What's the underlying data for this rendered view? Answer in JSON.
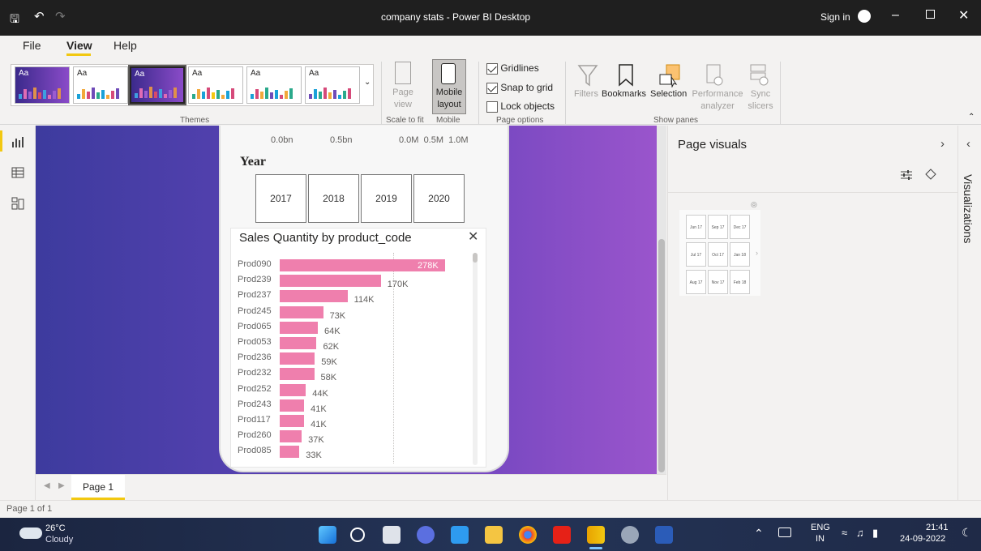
{
  "titlebar": {
    "title": "company stats - Power BI Desktop",
    "signin": "Sign in"
  },
  "menu": {
    "file": "File",
    "view": "View",
    "help": "Help"
  },
  "ribbon": {
    "themes_label": "Themes",
    "page_view": "Page view",
    "scale_to_fit": "Scale to fit",
    "mobile_layout": "Mobile layout",
    "mobile": "Mobile",
    "gridlines": "Gridlines",
    "snap_to_grid": "Snap to grid",
    "lock_objects": "Lock objects",
    "page_options": "Page options",
    "filters": "Filters",
    "bookmarks": "Bookmarks",
    "selection": "Selection",
    "performance": "Performance analyzer",
    "sync_slicers": "Sync slicers",
    "show_panes": "Show panes",
    "theme_aa": "Aa"
  },
  "phone": {
    "axis_left_0": "0.0bn",
    "axis_left_1": "0.5bn",
    "axis_right": "0.0M  0.5M  1.0M",
    "slicer_title": "Year",
    "years": [
      "2017",
      "2018",
      "2019",
      "2020"
    ]
  },
  "chart_data": {
    "type": "bar",
    "title": "Sales Quantity by product_code",
    "categories": [
      "Prod090",
      "Prod239",
      "Prod237",
      "Prod245",
      "Prod065",
      "Prod053",
      "Prod236",
      "Prod232",
      "Prod252",
      "Prod243",
      "Prod117",
      "Prod260",
      "Prod085"
    ],
    "values": [
      278000,
      170000,
      114000,
      73000,
      64000,
      62000,
      59000,
      58000,
      44000,
      41000,
      41000,
      37000,
      33000
    ],
    "labels": [
      "278K",
      "170K",
      "114K",
      "73K",
      "64K",
      "62K",
      "59K",
      "58K",
      "44K",
      "41K",
      "41K",
      "37K",
      "33K"
    ],
    "color": "#ef7fad"
  },
  "right_pane": {
    "title": "Page visuals",
    "vis_tab": "Visualizations",
    "mini_dates": [
      "Jun 17",
      "Sep 17",
      "Dec 17",
      "Jul 17",
      "Oct 17",
      "Jan 18",
      "Aug 17",
      "Nov 17",
      "Feb 18"
    ]
  },
  "pagebar": {
    "tab": "Page 1"
  },
  "status": {
    "text": "Page 1 of 1"
  },
  "taskbar": {
    "temp": "26°C",
    "weather": "Cloudy",
    "lang1": "ENG",
    "lang2": "IN",
    "time": "21:41",
    "date": "24-09-2022"
  },
  "colors": {
    "accent": "#f2c811",
    "bar": "#ef7fad",
    "purple": "#6a44b8"
  }
}
